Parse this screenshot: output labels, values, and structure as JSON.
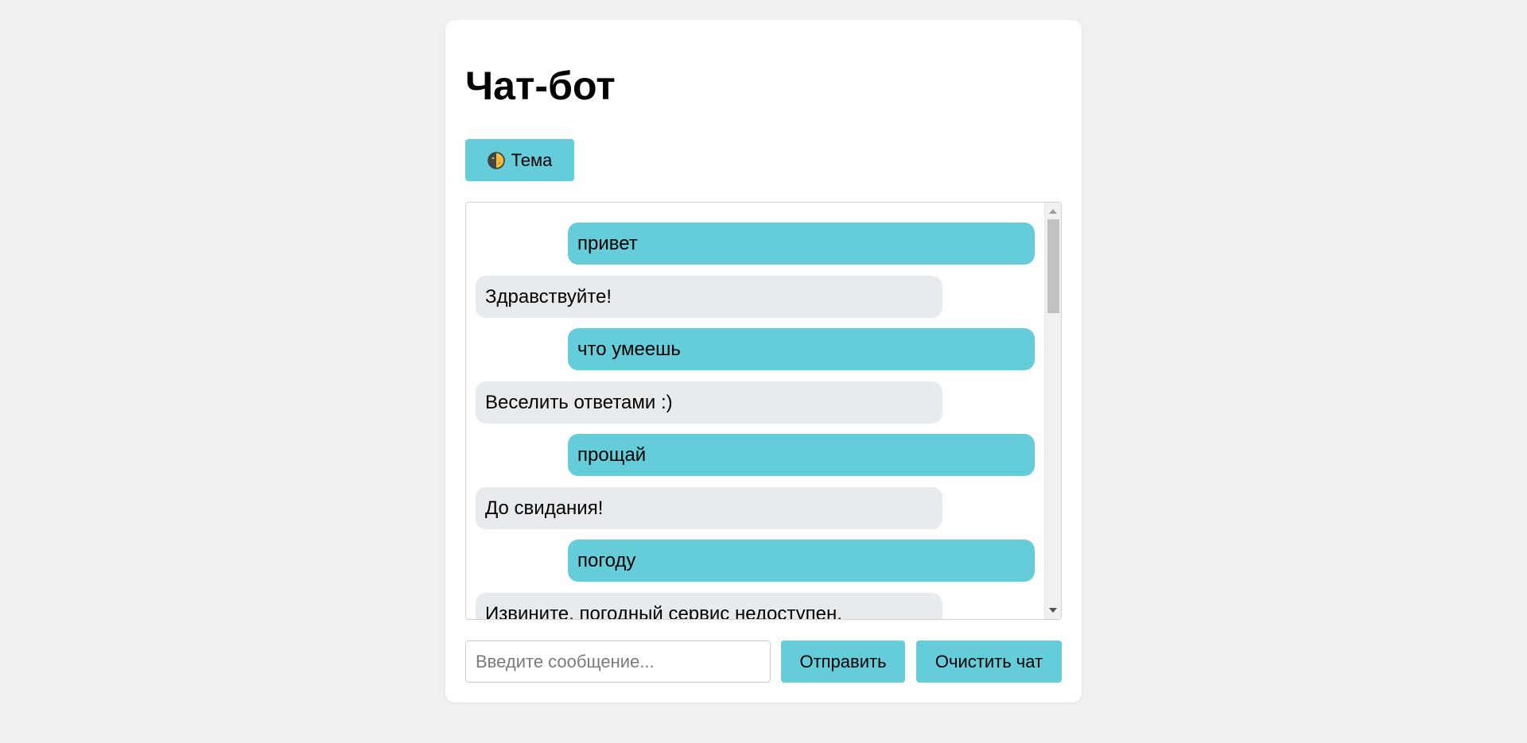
{
  "header": {
    "title": "Чат-бот",
    "theme_button_label": "Тема",
    "theme_icon": "half-moon-icon"
  },
  "chat": {
    "messages": [
      {
        "sender": "user",
        "text": "привет"
      },
      {
        "sender": "bot",
        "text": "Здравствуйте!"
      },
      {
        "sender": "user",
        "text": "что умеешь"
      },
      {
        "sender": "bot",
        "text": "Веселить ответами :)"
      },
      {
        "sender": "user",
        "text": "прощай"
      },
      {
        "sender": "bot",
        "text": "До свидания!"
      },
      {
        "sender": "user",
        "text": "погоду"
      },
      {
        "sender": "bot",
        "text": "Извините, погодный сервис недоступен."
      }
    ]
  },
  "composer": {
    "input_value": "",
    "input_placeholder": "Введите сообщение...",
    "send_label": "Отправить",
    "clear_label": "Очистить чат"
  },
  "colors": {
    "page_background": "#eff0f1",
    "accent": "#65cdd9",
    "bot_bubble": "#e8ebee",
    "card": "#ffffff"
  }
}
